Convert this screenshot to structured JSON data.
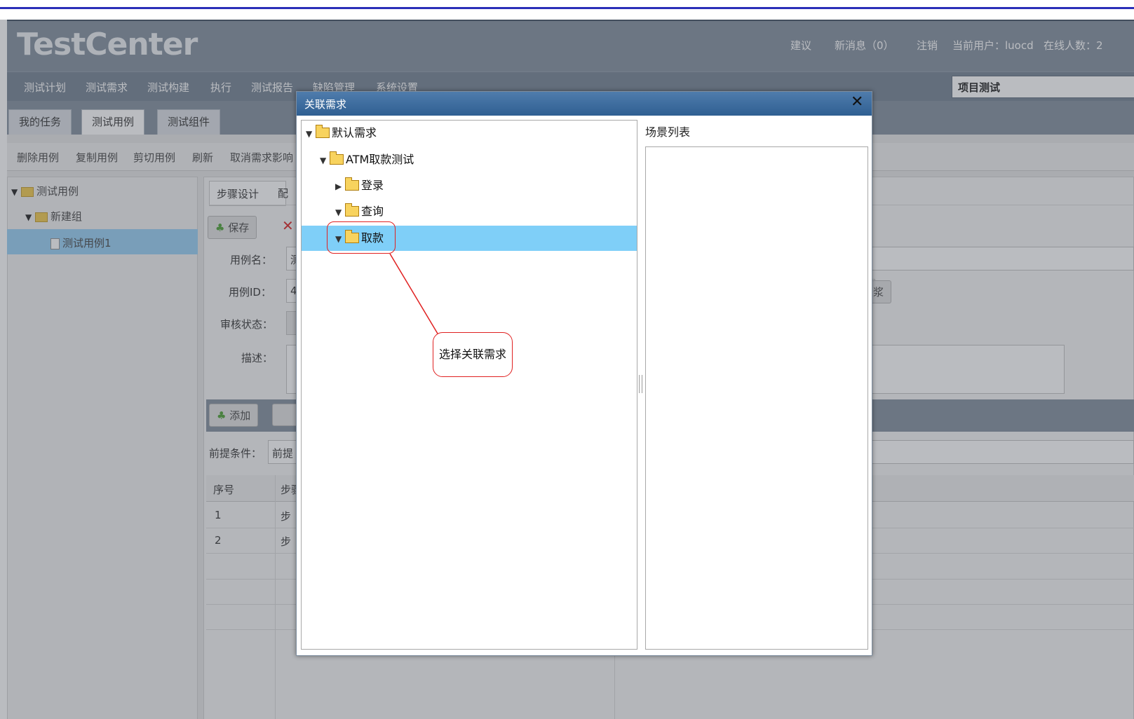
{
  "header": {
    "logo_text": "TestCenter",
    "links": [
      "建议",
      "新消息（0）",
      "注销"
    ],
    "current_user_label": "当前用户：luocd",
    "online_label": "在线人数：2"
  },
  "menu": {
    "items": [
      "测试计划",
      "测试需求",
      "测试构建",
      "执行",
      "测试报告",
      "缺陷管理",
      "系统设置"
    ],
    "project_select": "项目测试"
  },
  "tabs": [
    "我的任务",
    "测试用例",
    "测试组件"
  ],
  "toolbar": [
    "删除用例",
    "复制用例",
    "剪切用例",
    "刷新",
    "取消需求影响"
  ],
  "left_tree": {
    "root": "测试用例",
    "group": "新建组",
    "case": "测试用例1"
  },
  "background": {
    "subtabs": [
      "步骤设计",
      "配"
    ],
    "save_label": "保存",
    "field_labels": [
      "用例名：",
      "用例ID：",
      "审核状态：",
      "描述："
    ],
    "field_value_prefixes": [
      "测",
      "4"
    ],
    "behind_button_fragment": "浆",
    "add_label": "添加",
    "precondition_label": "前提条件：",
    "precondition_value": "前提",
    "table_headers": [
      "序号",
      "步骤"
    ],
    "rows": [
      [
        "1",
        "步"
      ],
      [
        "2",
        "步"
      ]
    ]
  },
  "modal": {
    "title": "关联需求",
    "close_symbol": "✕",
    "right_label": "场景列表",
    "tree": [
      {
        "label": "默认需求",
        "expanded": true,
        "level": 0
      },
      {
        "label": "ATM取款测试",
        "expanded": true,
        "level": 1
      },
      {
        "label": "登录",
        "expanded": false,
        "level": 2
      },
      {
        "label": "查询",
        "expanded": true,
        "level": 2
      },
      {
        "label": "取款",
        "expanded": true,
        "level": 2,
        "selected": true
      }
    ]
  },
  "annotation": {
    "text": "选择关联需求",
    "color": "#e02020"
  }
}
